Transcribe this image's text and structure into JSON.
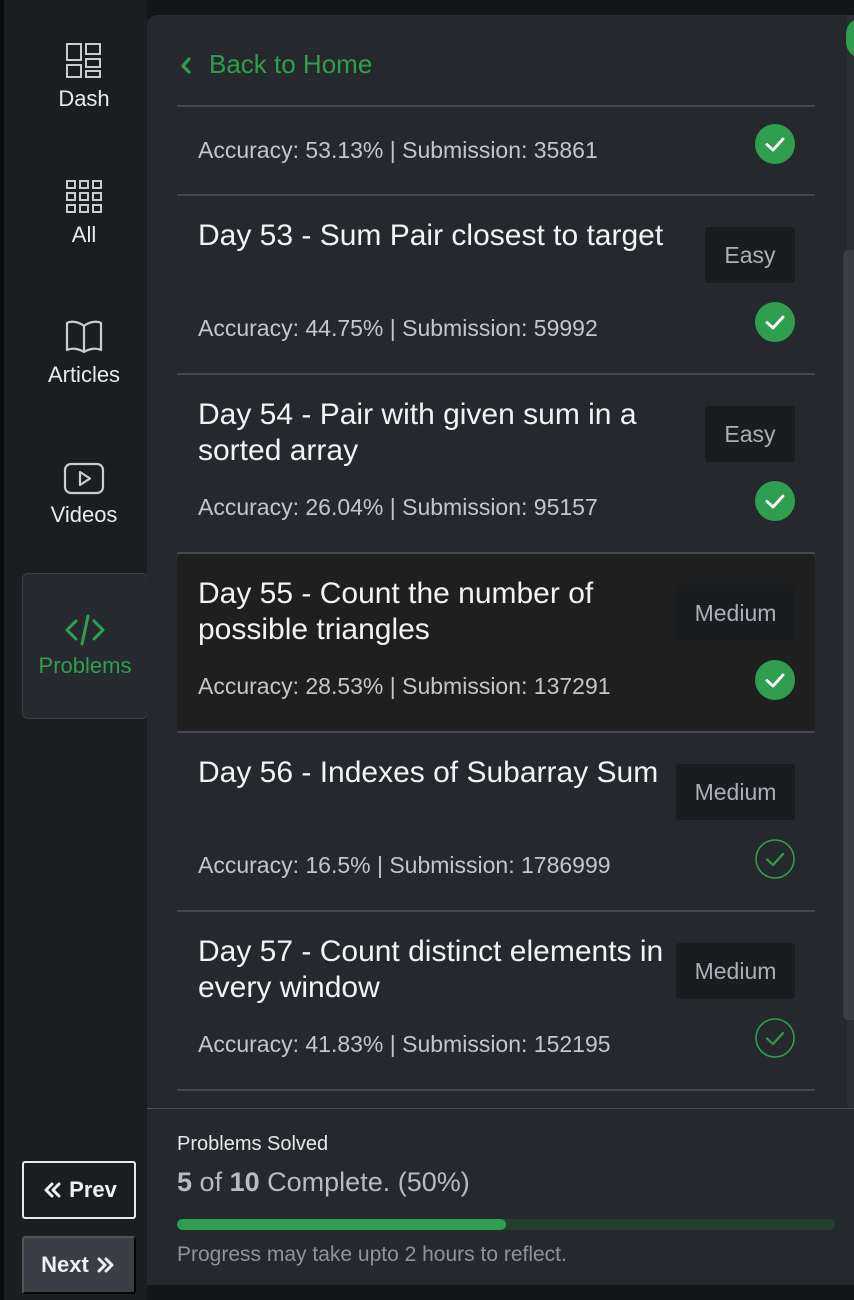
{
  "sidebar": {
    "items": [
      {
        "label": "Dash",
        "icon": "dashboard-icon"
      },
      {
        "label": "All",
        "icon": "grid-icon"
      },
      {
        "label": "Articles",
        "icon": "book-icon"
      },
      {
        "label": "Videos",
        "icon": "play-icon"
      },
      {
        "label": "Problems",
        "icon": "code-icon",
        "active": true
      }
    ]
  },
  "panel": {
    "back_label": "Back to Home"
  },
  "problems": [
    {
      "title": "",
      "stats": "Accuracy: 53.13% | Submission: 35861",
      "difficulty": "",
      "solved": true
    },
    {
      "title": "Day 53 - Sum Pair closest to target",
      "stats": "Accuracy: 44.75% | Submission: 59992",
      "difficulty": "Easy",
      "solved": true
    },
    {
      "title": "Day 54 - Pair with given sum in a sorted array",
      "stats": "Accuracy: 26.04% | Submission: 95157",
      "difficulty": "Easy",
      "solved": true
    },
    {
      "title": "Day 55 - Count the number of possible triangles",
      "stats": "Accuracy: 28.53% | Submission: 137291",
      "difficulty": "Medium",
      "solved": true
    },
    {
      "title": "Day 56 - Indexes of Subarray Sum",
      "stats": "Accuracy: 16.5% | Submission: 1786999",
      "difficulty": "Medium",
      "solved": false
    },
    {
      "title": "Day 57 - Count distinct elements in every window",
      "stats": "Accuracy: 41.83% | Submission: 152195",
      "difficulty": "Medium",
      "solved": false
    }
  ],
  "progress": {
    "title": "Problems Solved",
    "solved": "5",
    "of_text": "of",
    "total": "10",
    "complete_text": "Complete. (50%)",
    "fraction": 0.5,
    "note": "Progress may take upto 2 hours to reflect."
  },
  "nav": {
    "prev_label": "Prev",
    "next_label": "Next"
  },
  "colors": {
    "accent": "#2f9e4f",
    "panel": "#25292d",
    "sidebar": "#1b1e21"
  }
}
